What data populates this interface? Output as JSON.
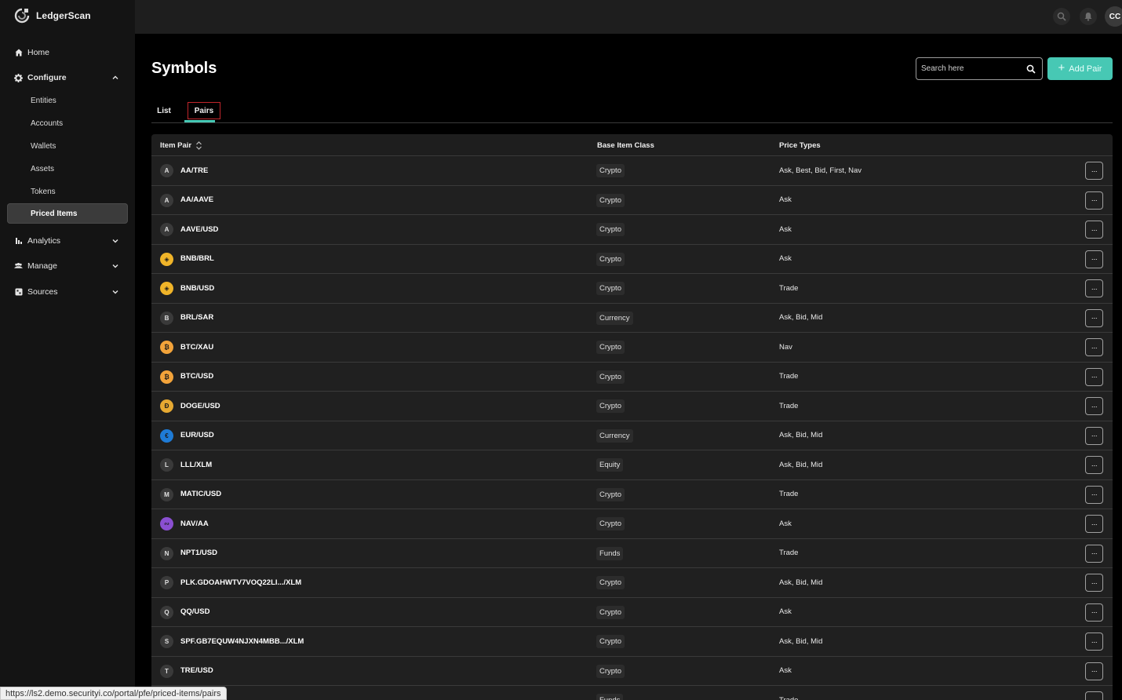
{
  "app": {
    "name": "LedgerScan"
  },
  "sidebar": {
    "home": "Home",
    "configure": "Configure",
    "configure_items": [
      "Entities",
      "Accounts",
      "Wallets",
      "Assets",
      "Tokens",
      "Priced Items"
    ],
    "analytics": "Analytics",
    "manage": "Manage",
    "sources": "Sources"
  },
  "topbar": {
    "avatar_initials": "CC"
  },
  "page": {
    "title": "Symbols",
    "search_placeholder": "Search here",
    "add_button": "Add Pair",
    "tabs": [
      "List",
      "Pairs"
    ]
  },
  "table": {
    "headers": {
      "pair": "Item Pair",
      "class": "Base Item Class",
      "price": "Price Types"
    },
    "more_label": "···",
    "rows": [
      {
        "icon": "A",
        "icon_color": "#3a3a3a",
        "pair": "AA/TRE",
        "class": "Crypto",
        "price": "Ask, Best, Bid, First, Nav"
      },
      {
        "icon": "A",
        "icon_color": "#3a3a3a",
        "pair": "AA/AAVE",
        "class": "Crypto",
        "price": "Ask"
      },
      {
        "icon": "A",
        "icon_color": "#3a3a3a",
        "pair": "AAVE/USD",
        "class": "Crypto",
        "price": "Ask"
      },
      {
        "icon": "◈",
        "icon_color": "#f0b429",
        "pair": "BNB/BRL",
        "class": "Crypto",
        "price": "Ask"
      },
      {
        "icon": "◈",
        "icon_color": "#f0b429",
        "pair": "BNB/USD",
        "class": "Crypto",
        "price": "Trade"
      },
      {
        "icon": "B",
        "icon_color": "#3a3a3a",
        "pair": "BRL/SAR",
        "class": "Currency",
        "price": "Ask, Bid, Mid"
      },
      {
        "icon": "₿",
        "icon_color": "#f2a33a",
        "pair": "BTC/XAU",
        "class": "Crypto",
        "price": "Nav"
      },
      {
        "icon": "₿",
        "icon_color": "#f2a33a",
        "pair": "BTC/USD",
        "class": "Crypto",
        "price": "Trade"
      },
      {
        "icon": "Ð",
        "icon_color": "#e6a932",
        "pair": "DOGE/USD",
        "class": "Crypto",
        "price": "Trade"
      },
      {
        "icon": "€",
        "icon_color": "#1e7bd6",
        "pair": "EUR/USD",
        "class": "Currency",
        "price": "Ask, Bid, Mid"
      },
      {
        "icon": "L",
        "icon_color": "#3a3a3a",
        "pair": "LLL/XLM",
        "class": "Equity",
        "price": "Ask, Bid, Mid"
      },
      {
        "icon": "M",
        "icon_color": "#3a3a3a",
        "pair": "MATIC/USD",
        "class": "Crypto",
        "price": "Trade"
      },
      {
        "icon": "∾",
        "icon_color": "#8a4fd1",
        "pair": "NAV/AA",
        "class": "Crypto",
        "price": "Ask"
      },
      {
        "icon": "N",
        "icon_color": "#3a3a3a",
        "pair": "NPT1/USD",
        "class": "Funds",
        "price": "Trade"
      },
      {
        "icon": "P",
        "icon_color": "#3a3a3a",
        "pair": "PLK.GDOAHWTV7VOQ22LI.../XLM",
        "class": "Crypto",
        "price": "Ask, Bid, Mid"
      },
      {
        "icon": "Q",
        "icon_color": "#3a3a3a",
        "pair": "QQ/USD",
        "class": "Crypto",
        "price": "Ask"
      },
      {
        "icon": "S",
        "icon_color": "#3a3a3a",
        "pair": "SPF.GB7EQUW4NJXN4MBB.../XLM",
        "class": "Crypto",
        "price": "Ask, Bid, Mid"
      },
      {
        "icon": "T",
        "icon_color": "#3a3a3a",
        "pair": "TRE/USD",
        "class": "Crypto",
        "price": "Ask"
      },
      {
        "icon": "",
        "icon_color": "#3a3a3a",
        "pair": "",
        "class": "Funds",
        "price": "Trade"
      }
    ]
  },
  "statusbar": {
    "url": "https://ls2.demo.securityi.co/portal/pfe/priced-items/pairs"
  },
  "colors": {
    "accent": "#47c8b4",
    "highlight_box": "#c0262b"
  }
}
